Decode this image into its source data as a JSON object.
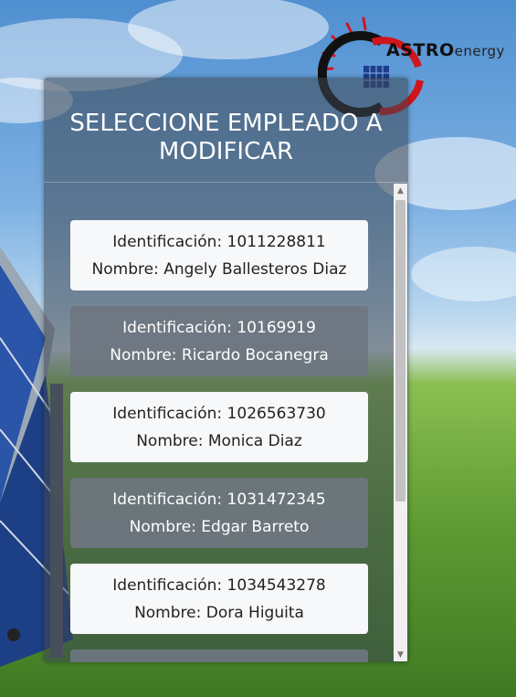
{
  "logo": {
    "text_bold": "ASTRO",
    "text_light": "energy"
  },
  "header": {
    "title": "SELECCIONE EMPLEADO A MODIFICAR"
  },
  "employees": [
    {
      "id_line": "Identificación: 1011228811",
      "name_line": "Nombre: Angely Ballesteros Diaz"
    },
    {
      "id_line": "Identificación: 10169919",
      "name_line": "Nombre: Ricardo Bocanegra"
    },
    {
      "id_line": "Identificación: 1026563730",
      "name_line": "Nombre: Monica Diaz"
    },
    {
      "id_line": "Identificación: 1031472345",
      "name_line": "Nombre: Edgar Barreto"
    },
    {
      "id_line": "Identificación: 1034543278",
      "name_line": "Nombre: Dora Higuita"
    },
    {
      "id_line": "",
      "name_line": ""
    }
  ],
  "scrollbar": {
    "up_icon": "arrow-up-icon",
    "down_icon": "arrow-down-icon"
  }
}
